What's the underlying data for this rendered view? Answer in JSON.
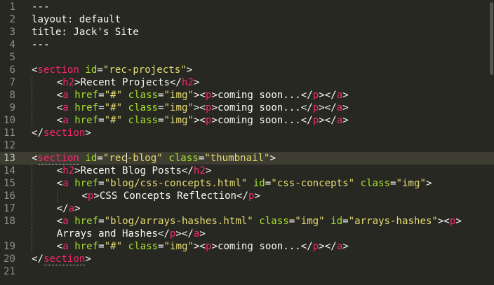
{
  "editor": {
    "active_line": 13,
    "lines": [
      {
        "n": "1",
        "tokens": [
          [
            "p",
            "---"
          ]
        ]
      },
      {
        "n": "2",
        "tokens": [
          [
            "p",
            "layout: default"
          ]
        ]
      },
      {
        "n": "3",
        "tokens": [
          [
            "p",
            "title: Jack's Site"
          ]
        ]
      },
      {
        "n": "4",
        "tokens": [
          [
            "p",
            "---"
          ]
        ]
      },
      {
        "n": "5",
        "tokens": []
      },
      {
        "n": "6",
        "tokens": [
          [
            "p",
            "<"
          ],
          [
            "t",
            "section"
          ],
          [
            "p",
            " "
          ],
          [
            "a",
            "id"
          ],
          [
            "p",
            "="
          ],
          [
            "s",
            "\"rec-projects\""
          ],
          [
            "p",
            ">"
          ]
        ]
      },
      {
        "n": "7",
        "indent": 1,
        "tokens": [
          [
            "p",
            "<"
          ],
          [
            "t",
            "h2"
          ],
          [
            "p",
            ">Recent Projects</"
          ],
          [
            "t",
            "h2"
          ],
          [
            "p",
            ">"
          ]
        ]
      },
      {
        "n": "8",
        "indent": 1,
        "tokens": [
          [
            "p",
            "<"
          ],
          [
            "t",
            "a"
          ],
          [
            "p",
            " "
          ],
          [
            "a",
            "href"
          ],
          [
            "p",
            "="
          ],
          [
            "s",
            "\"#\""
          ],
          [
            "p",
            " "
          ],
          [
            "a",
            "class"
          ],
          [
            "p",
            "="
          ],
          [
            "s",
            "\"img\""
          ],
          [
            "p",
            "><"
          ],
          [
            "t",
            "p"
          ],
          [
            "p",
            ">coming soon...</"
          ],
          [
            "t",
            "p"
          ],
          [
            "p",
            "></"
          ],
          [
            "t",
            "a"
          ],
          [
            "p",
            ">"
          ]
        ]
      },
      {
        "n": "9",
        "indent": 1,
        "tokens": [
          [
            "p",
            "<"
          ],
          [
            "t",
            "a"
          ],
          [
            "p",
            " "
          ],
          [
            "a",
            "href"
          ],
          [
            "p",
            "="
          ],
          [
            "s",
            "\"#\""
          ],
          [
            "p",
            " "
          ],
          [
            "a",
            "class"
          ],
          [
            "p",
            "="
          ],
          [
            "s",
            "\"img\""
          ],
          [
            "p",
            "><"
          ],
          [
            "t",
            "p"
          ],
          [
            "p",
            ">coming soon...</"
          ],
          [
            "t",
            "p"
          ],
          [
            "p",
            "></"
          ],
          [
            "t",
            "a"
          ],
          [
            "p",
            ">"
          ]
        ]
      },
      {
        "n": "10",
        "indent": 1,
        "tokens": [
          [
            "p",
            "<"
          ],
          [
            "t",
            "a"
          ],
          [
            "p",
            " "
          ],
          [
            "a",
            "href"
          ],
          [
            "p",
            "="
          ],
          [
            "s",
            "\"#\""
          ],
          [
            "p",
            " "
          ],
          [
            "a",
            "class"
          ],
          [
            "p",
            "="
          ],
          [
            "s",
            "\"img\""
          ],
          [
            "p",
            "><"
          ],
          [
            "t",
            "p"
          ],
          [
            "p",
            ">coming soon...</"
          ],
          [
            "t",
            "p"
          ],
          [
            "p",
            "></"
          ],
          [
            "t",
            "a"
          ],
          [
            "p",
            ">"
          ]
        ]
      },
      {
        "n": "11",
        "tokens": [
          [
            "p",
            "</"
          ],
          [
            "t",
            "section"
          ],
          [
            "p",
            ">"
          ]
        ]
      },
      {
        "n": "12",
        "tokens": []
      },
      {
        "n": "13",
        "tokens": [
          [
            "p",
            "<"
          ],
          [
            "t",
            "section",
            "u"
          ],
          [
            "p",
            " "
          ],
          [
            "a",
            "id"
          ],
          [
            "p",
            "="
          ],
          [
            "s",
            "\"rec"
          ],
          [
            "caret",
            ""
          ],
          [
            "s",
            "-blog\""
          ],
          [
            "p",
            " "
          ],
          [
            "a",
            "class"
          ],
          [
            "p",
            "="
          ],
          [
            "s",
            "\"thumbnail\""
          ],
          [
            "p",
            ">"
          ]
        ]
      },
      {
        "n": "14",
        "indent": 1,
        "tokens": [
          [
            "p",
            "<"
          ],
          [
            "t",
            "h2"
          ],
          [
            "p",
            ">Recent Blog Posts</"
          ],
          [
            "t",
            "h2"
          ],
          [
            "p",
            ">"
          ]
        ]
      },
      {
        "n": "15",
        "indent": 1,
        "tokens": [
          [
            "p",
            "<"
          ],
          [
            "t",
            "a"
          ],
          [
            "p",
            " "
          ],
          [
            "a",
            "href"
          ],
          [
            "p",
            "="
          ],
          [
            "s",
            "\"blog/css-concepts.html\""
          ],
          [
            "p",
            " "
          ],
          [
            "a",
            "id"
          ],
          [
            "p",
            "="
          ],
          [
            "s",
            "\"css-concepts\""
          ],
          [
            "p",
            " "
          ],
          [
            "a",
            "class"
          ],
          [
            "p",
            "="
          ],
          [
            "s",
            "\"img\""
          ],
          [
            "p",
            ">"
          ]
        ]
      },
      {
        "n": "16",
        "indent": 2,
        "tokens": [
          [
            "p",
            "<"
          ],
          [
            "t",
            "p"
          ],
          [
            "p",
            ">CSS Concepts Reflection</"
          ],
          [
            "t",
            "p"
          ],
          [
            "p",
            ">"
          ]
        ]
      },
      {
        "n": "17",
        "indent": 1,
        "tokens": [
          [
            "p",
            "</"
          ],
          [
            "t",
            "a"
          ],
          [
            "p",
            ">"
          ]
        ]
      },
      {
        "n": "18",
        "indent": 1,
        "tokens": [
          [
            "p",
            "<"
          ],
          [
            "t",
            "a"
          ],
          [
            "p",
            " "
          ],
          [
            "a",
            "href"
          ],
          [
            "p",
            "="
          ],
          [
            "s",
            "\"blog/arrays-hashes.html\""
          ],
          [
            "p",
            " "
          ],
          [
            "a",
            "class"
          ],
          [
            "p",
            "="
          ],
          [
            "s",
            "\"img\""
          ],
          [
            "p",
            " "
          ],
          [
            "a",
            "id"
          ],
          [
            "p",
            "="
          ],
          [
            "s",
            "\"arrays-hashes\""
          ],
          [
            "p",
            "><"
          ],
          [
            "t",
            "p"
          ],
          [
            "p",
            ">"
          ]
        ]
      },
      {
        "n": "",
        "indent": 1,
        "wrap": true,
        "tokens": [
          [
            "p",
            "Arrays and Hashes</"
          ],
          [
            "t",
            "p"
          ],
          [
            "p",
            "></"
          ],
          [
            "t",
            "a"
          ],
          [
            "p",
            ">"
          ]
        ]
      },
      {
        "n": "19",
        "indent": 1,
        "tokens": [
          [
            "p",
            "<"
          ],
          [
            "t",
            "a"
          ],
          [
            "p",
            " "
          ],
          [
            "a",
            "href"
          ],
          [
            "p",
            "="
          ],
          [
            "s",
            "\"#\""
          ],
          [
            "p",
            " "
          ],
          [
            "a",
            "class"
          ],
          [
            "p",
            "="
          ],
          [
            "s",
            "\"img\""
          ],
          [
            "p",
            "><"
          ],
          [
            "t",
            "p"
          ],
          [
            "p",
            ">coming soon...</"
          ],
          [
            "t",
            "p"
          ],
          [
            "p",
            "></"
          ],
          [
            "t",
            "a"
          ],
          [
            "p",
            ">"
          ]
        ]
      },
      {
        "n": "20",
        "tokens": [
          [
            "p",
            "</"
          ],
          [
            "t",
            "section",
            "u"
          ],
          [
            "p",
            ">"
          ]
        ]
      },
      {
        "n": "21",
        "tokens": []
      }
    ]
  },
  "colors": {
    "background": "#272822",
    "tag": "#f92672",
    "attribute": "#a6e22e",
    "string": "#e6db74",
    "plain": "#f8f8f2",
    "line_number": "#8f908a"
  }
}
